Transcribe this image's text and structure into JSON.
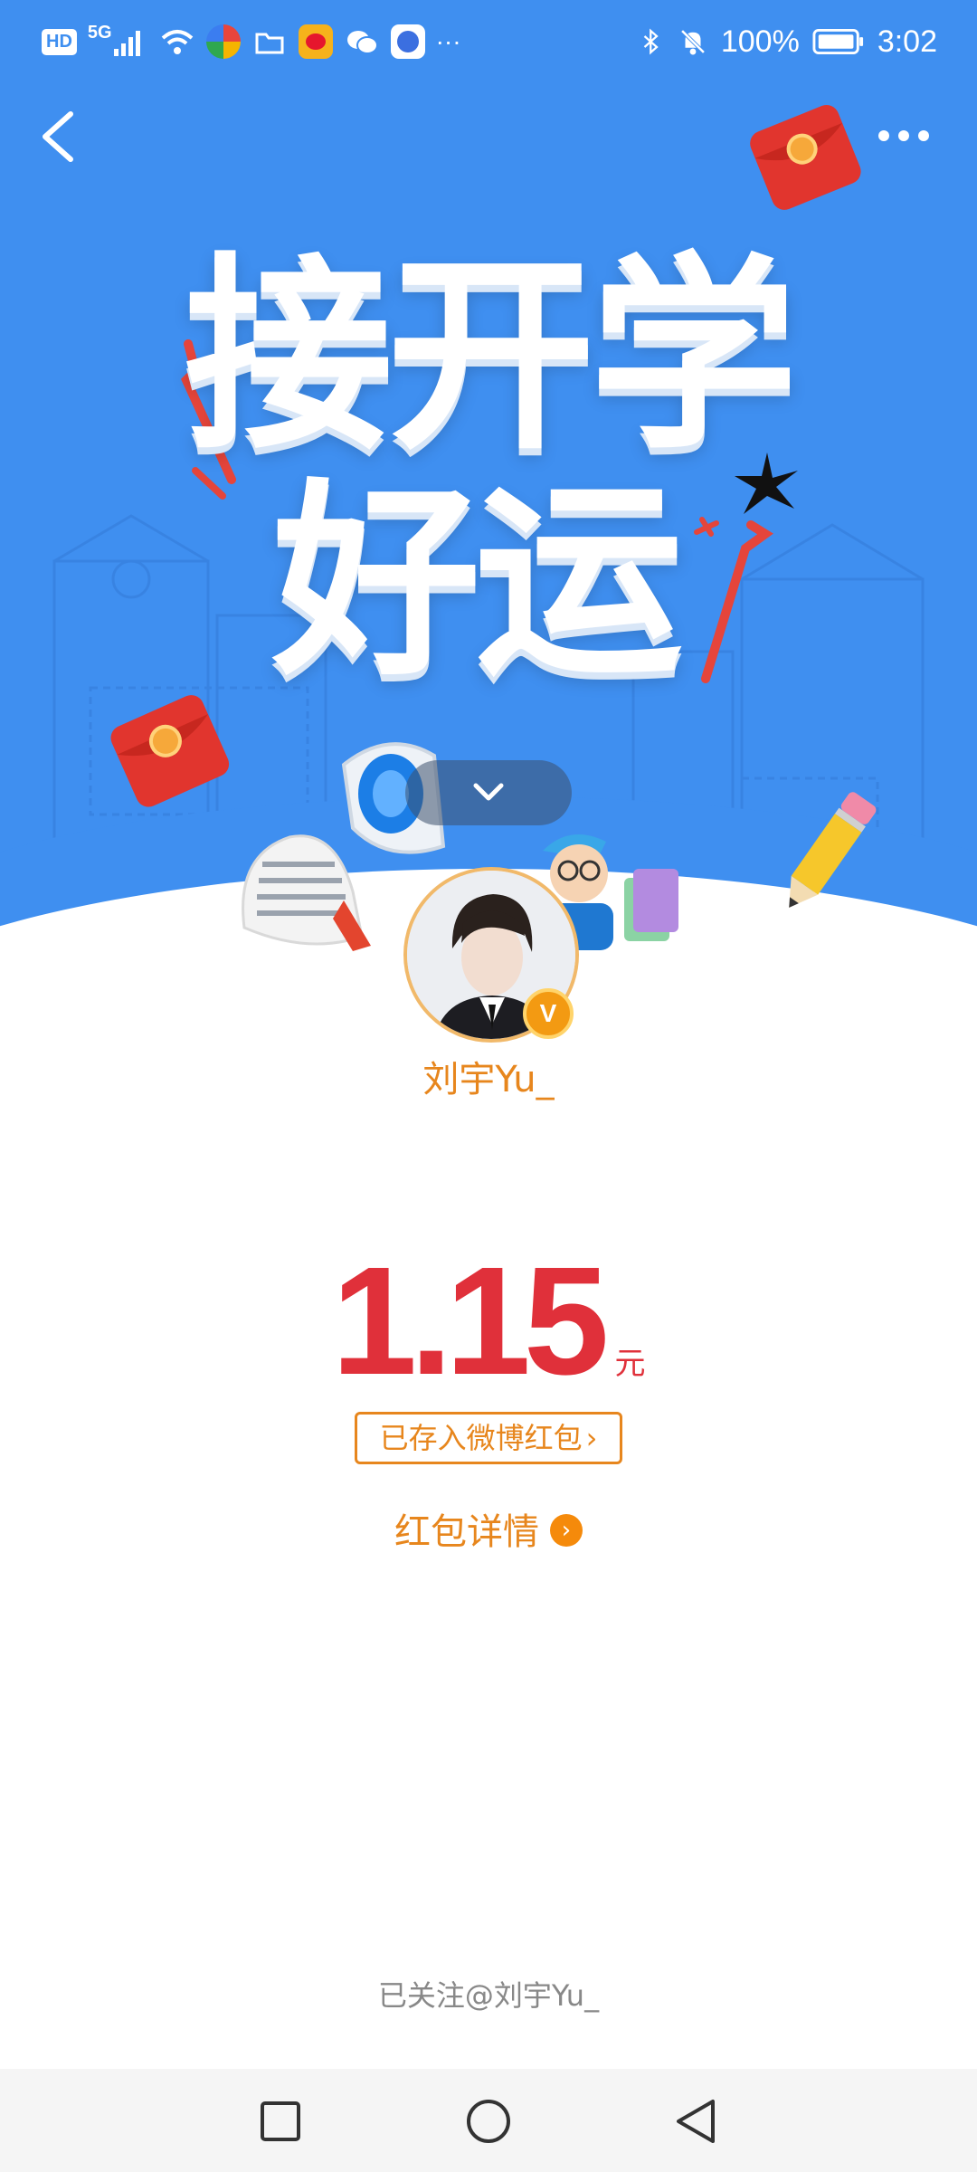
{
  "status_bar": {
    "network_label": "HD",
    "signal_label": "5G",
    "battery": "100%",
    "time": "3:02",
    "overflow": "···",
    "icons": [
      "signal-icon",
      "wifi-icon",
      "app-icon",
      "folder-icon",
      "weibo-icon",
      "wechat-icon",
      "browser-icon",
      "bluetooth-icon",
      "mute-bell-icon",
      "battery-icon"
    ]
  },
  "banner": {
    "title_line1": "接开学",
    "title_line2": "好运",
    "bg_color": "#3f8ff0"
  },
  "sender": {
    "name": "刘宇Yu_",
    "verified_badge": "V"
  },
  "red_packet": {
    "amount": "1.15",
    "unit": "元",
    "saved_label": "已存入微博红包",
    "details_label": "红包详情",
    "amount_color": "#e0303a",
    "accent_color": "#e7861d"
  },
  "footer": {
    "followed_text": "已关注@刘宇Yu_"
  },
  "nav": {
    "icons": [
      "recents-square-icon",
      "home-circle-icon",
      "back-triangle-icon"
    ]
  }
}
